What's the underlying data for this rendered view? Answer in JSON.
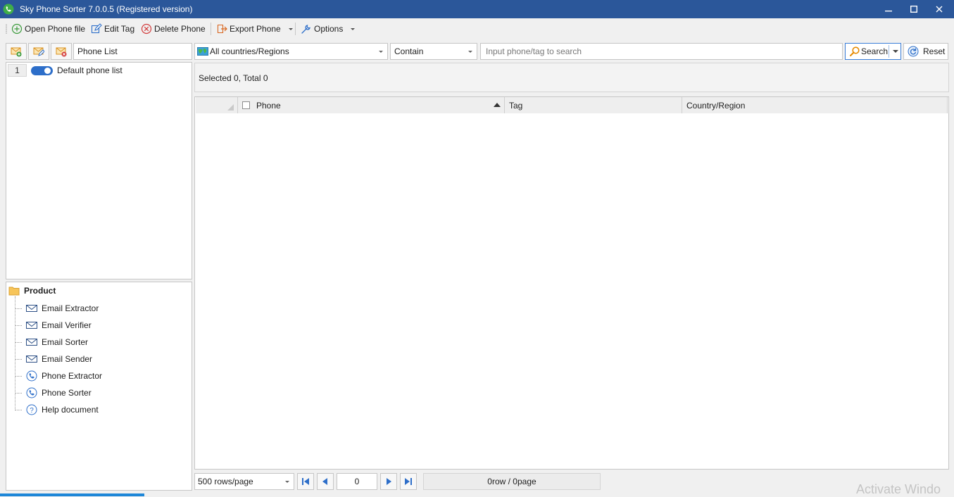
{
  "window": {
    "title": "Sky Phone Sorter 7.0.0.5 (Registered version)"
  },
  "toolbar": {
    "open_label": "Open Phone file",
    "edit_label": "Edit Tag",
    "delete_label": "Delete Phone",
    "export_label": "Export Phone",
    "options_label": "Options"
  },
  "left": {
    "list_header": "Phone List",
    "lists": [
      {
        "index": "1",
        "name": "Default phone list",
        "enabled": true
      }
    ]
  },
  "product": {
    "title": "Product",
    "items": [
      {
        "label": "Email Extractor",
        "icon": "envelope-icon"
      },
      {
        "label": "Email Verifier",
        "icon": "envelope-icon"
      },
      {
        "label": "Email Sorter",
        "icon": "envelope-icon"
      },
      {
        "label": "Email Sender",
        "icon": "envelope-icon"
      },
      {
        "label": "Phone Extractor",
        "icon": "phone-icon"
      },
      {
        "label": "Phone Sorter",
        "icon": "phone-icon"
      },
      {
        "label": "Help document",
        "icon": "help-icon"
      }
    ]
  },
  "filter": {
    "country": "All countries/Regions",
    "match": "Contain",
    "search_placeholder": "Input phone/tag to search",
    "search_label": "Search",
    "reset_label": "Reset"
  },
  "status": {
    "text": "Selected 0, Total 0"
  },
  "table": {
    "columns": [
      "Phone",
      "Tag",
      "Country/Region"
    ],
    "sort_column": "Phone",
    "sort": "ascending",
    "rows": []
  },
  "pager": {
    "rows_per_page": "500 rows/page",
    "page": "0",
    "info": "0row / 0page"
  },
  "watermark": "Activate Windo",
  "colors": {
    "titlebar": "#2b579a",
    "accent": "#2d6ec9",
    "selected_border": "#3c7fd8"
  }
}
